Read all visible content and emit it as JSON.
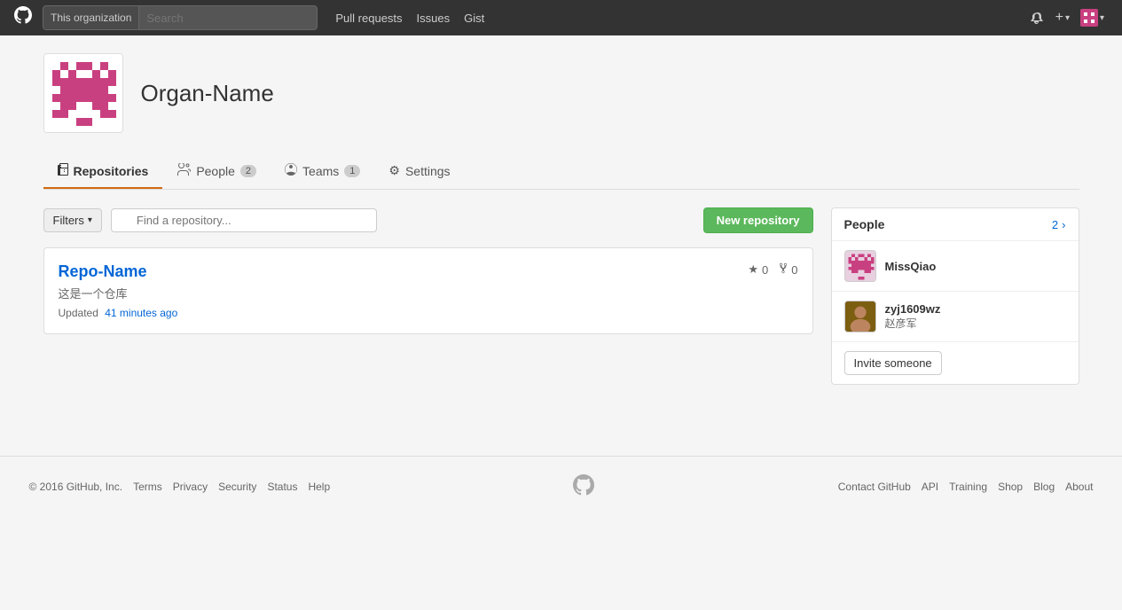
{
  "header": {
    "logo_symbol": "⊛",
    "search_scope": "This organization",
    "search_placeholder": "Search",
    "nav": [
      {
        "label": "Pull requests",
        "href": "#"
      },
      {
        "label": "Issues",
        "href": "#"
      },
      {
        "label": "Gist",
        "href": "#"
      }
    ],
    "bell_icon": "🔔",
    "plus_label": "+",
    "avatar_label": "🟥"
  },
  "org": {
    "name": "Organ-Name"
  },
  "tabs": [
    {
      "id": "repositories",
      "label": "Repositories",
      "badge": null,
      "active": true
    },
    {
      "id": "people",
      "label": "People",
      "badge": "2",
      "active": false
    },
    {
      "id": "teams",
      "label": "Teams",
      "badge": "1",
      "active": false
    },
    {
      "id": "settings",
      "label": "Settings",
      "badge": null,
      "active": false
    }
  ],
  "filters": {
    "button_label": "Filters",
    "search_placeholder": "Find a repository...",
    "new_repo_label": "New repository"
  },
  "repos": [
    {
      "name": "Repo-Name",
      "description": "这是一个仓库",
      "stars": "0",
      "forks": "0",
      "updated_prefix": "Updated",
      "updated_link": "41 minutes ago"
    }
  ],
  "people_sidebar": {
    "title": "People",
    "count": "2",
    "count_arrow": "›",
    "members": [
      {
        "username": "MissQiao",
        "alias": null,
        "avatar_type": "pixel"
      },
      {
        "username": "zyj1609wz",
        "alias": "赵彦军",
        "avatar_type": "photo"
      }
    ],
    "invite_label": "Invite someone"
  },
  "footer": {
    "copyright": "© 2016 GitHub, Inc.",
    "links": [
      "Terms",
      "Privacy",
      "Security",
      "Status",
      "Help"
    ],
    "right_links": [
      "Contact GitHub",
      "API",
      "Training",
      "Shop",
      "Blog",
      "About"
    ]
  }
}
